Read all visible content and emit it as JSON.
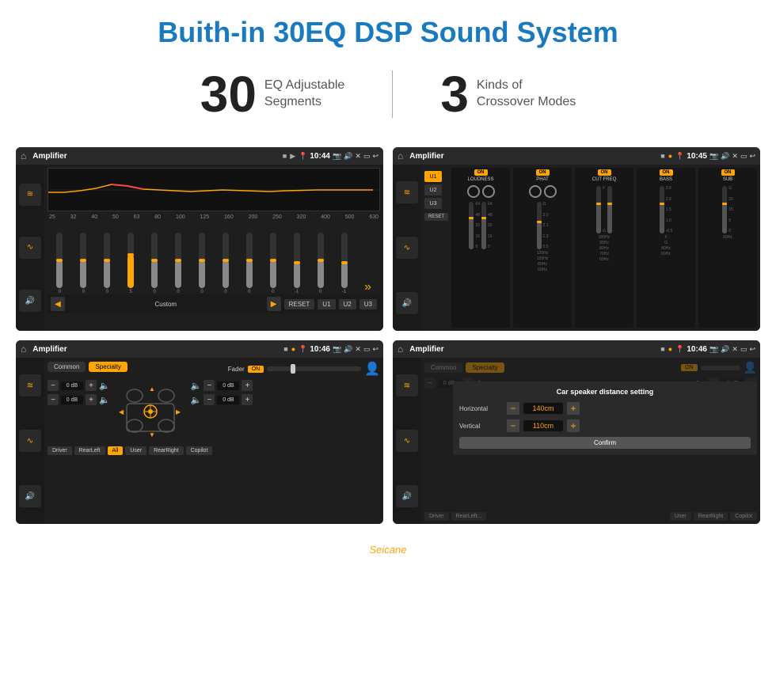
{
  "page": {
    "title": "Buith-in 30EQ DSP Sound System",
    "title_color": "#1a7abf"
  },
  "stats": {
    "eq_number": "30",
    "eq_label_line1": "EQ Adjustable",
    "eq_label_line2": "Segments",
    "crossover_number": "3",
    "crossover_label_line1": "Kinds of",
    "crossover_label_line2": "Crossover Modes"
  },
  "screen1": {
    "title": "Amplifier",
    "time": "10:44",
    "freq_labels": [
      "25",
      "32",
      "40",
      "50",
      "63",
      "80",
      "100",
      "125",
      "160",
      "200",
      "250",
      "320",
      "400",
      "500",
      "630"
    ],
    "slider_vals": [
      "0",
      "0",
      "0",
      "5",
      "0",
      "0",
      "0",
      "0",
      "0",
      "0",
      "-1",
      "0",
      "-1"
    ],
    "bottom_btns": [
      "Custom",
      "RESET",
      "U1",
      "U2",
      "U3"
    ],
    "active_btn": "Custom"
  },
  "screen2": {
    "title": "Amplifier",
    "time": "10:45",
    "u_btns": [
      "U1",
      "U2",
      "U3"
    ],
    "active_u": "U1",
    "col_titles": [
      "LOUDNESS",
      "PHAT",
      "CUT FREQ",
      "BASS",
      "SUB"
    ],
    "on_btns": [
      "ON",
      "ON",
      "ON",
      "ON",
      "ON"
    ],
    "reset_label": "RESET"
  },
  "screen3": {
    "title": "Amplifier",
    "time": "10:46",
    "tabs": [
      "Common",
      "Specialty"
    ],
    "active_tab": "Specialty",
    "fader_label": "Fader",
    "fader_on": "ON",
    "db_values": [
      "0 dB",
      "0 dB",
      "0 dB",
      "0 dB"
    ],
    "bottom_btns": [
      "Driver",
      "RearLeft",
      "All",
      "User",
      "RearRight",
      "Copilot"
    ],
    "active_bottom": "All"
  },
  "screen4": {
    "title": "Amplifier",
    "time": "10:46",
    "tabs": [
      "Common",
      "Specialty"
    ],
    "active_tab": "Specialty",
    "dialog_title": "Car speaker distance setting",
    "horizontal_label": "Horizontal",
    "horizontal_value": "140cm",
    "vertical_label": "Vertical",
    "vertical_value": "110cm",
    "confirm_label": "Confirm",
    "db_values": [
      "0 dB",
      "0 dB"
    ],
    "bottom_btns": [
      "Driver",
      "RearLeft",
      "User",
      "RearRight",
      "Copilot"
    ]
  },
  "icons": {
    "home": "⌂",
    "signal": "▶",
    "location": "📍",
    "camera": "📷",
    "volume": "🔊",
    "close": "✕",
    "back": "↩",
    "person": "👤",
    "arrow_up": "▲",
    "arrow_down": "▼",
    "arrow_left": "◀",
    "arrow_right": "▶",
    "prev": "◀",
    "next": "▶",
    "more": "»",
    "eq_icon": "≋",
    "wave": "∿"
  },
  "watermark": "Seicane"
}
